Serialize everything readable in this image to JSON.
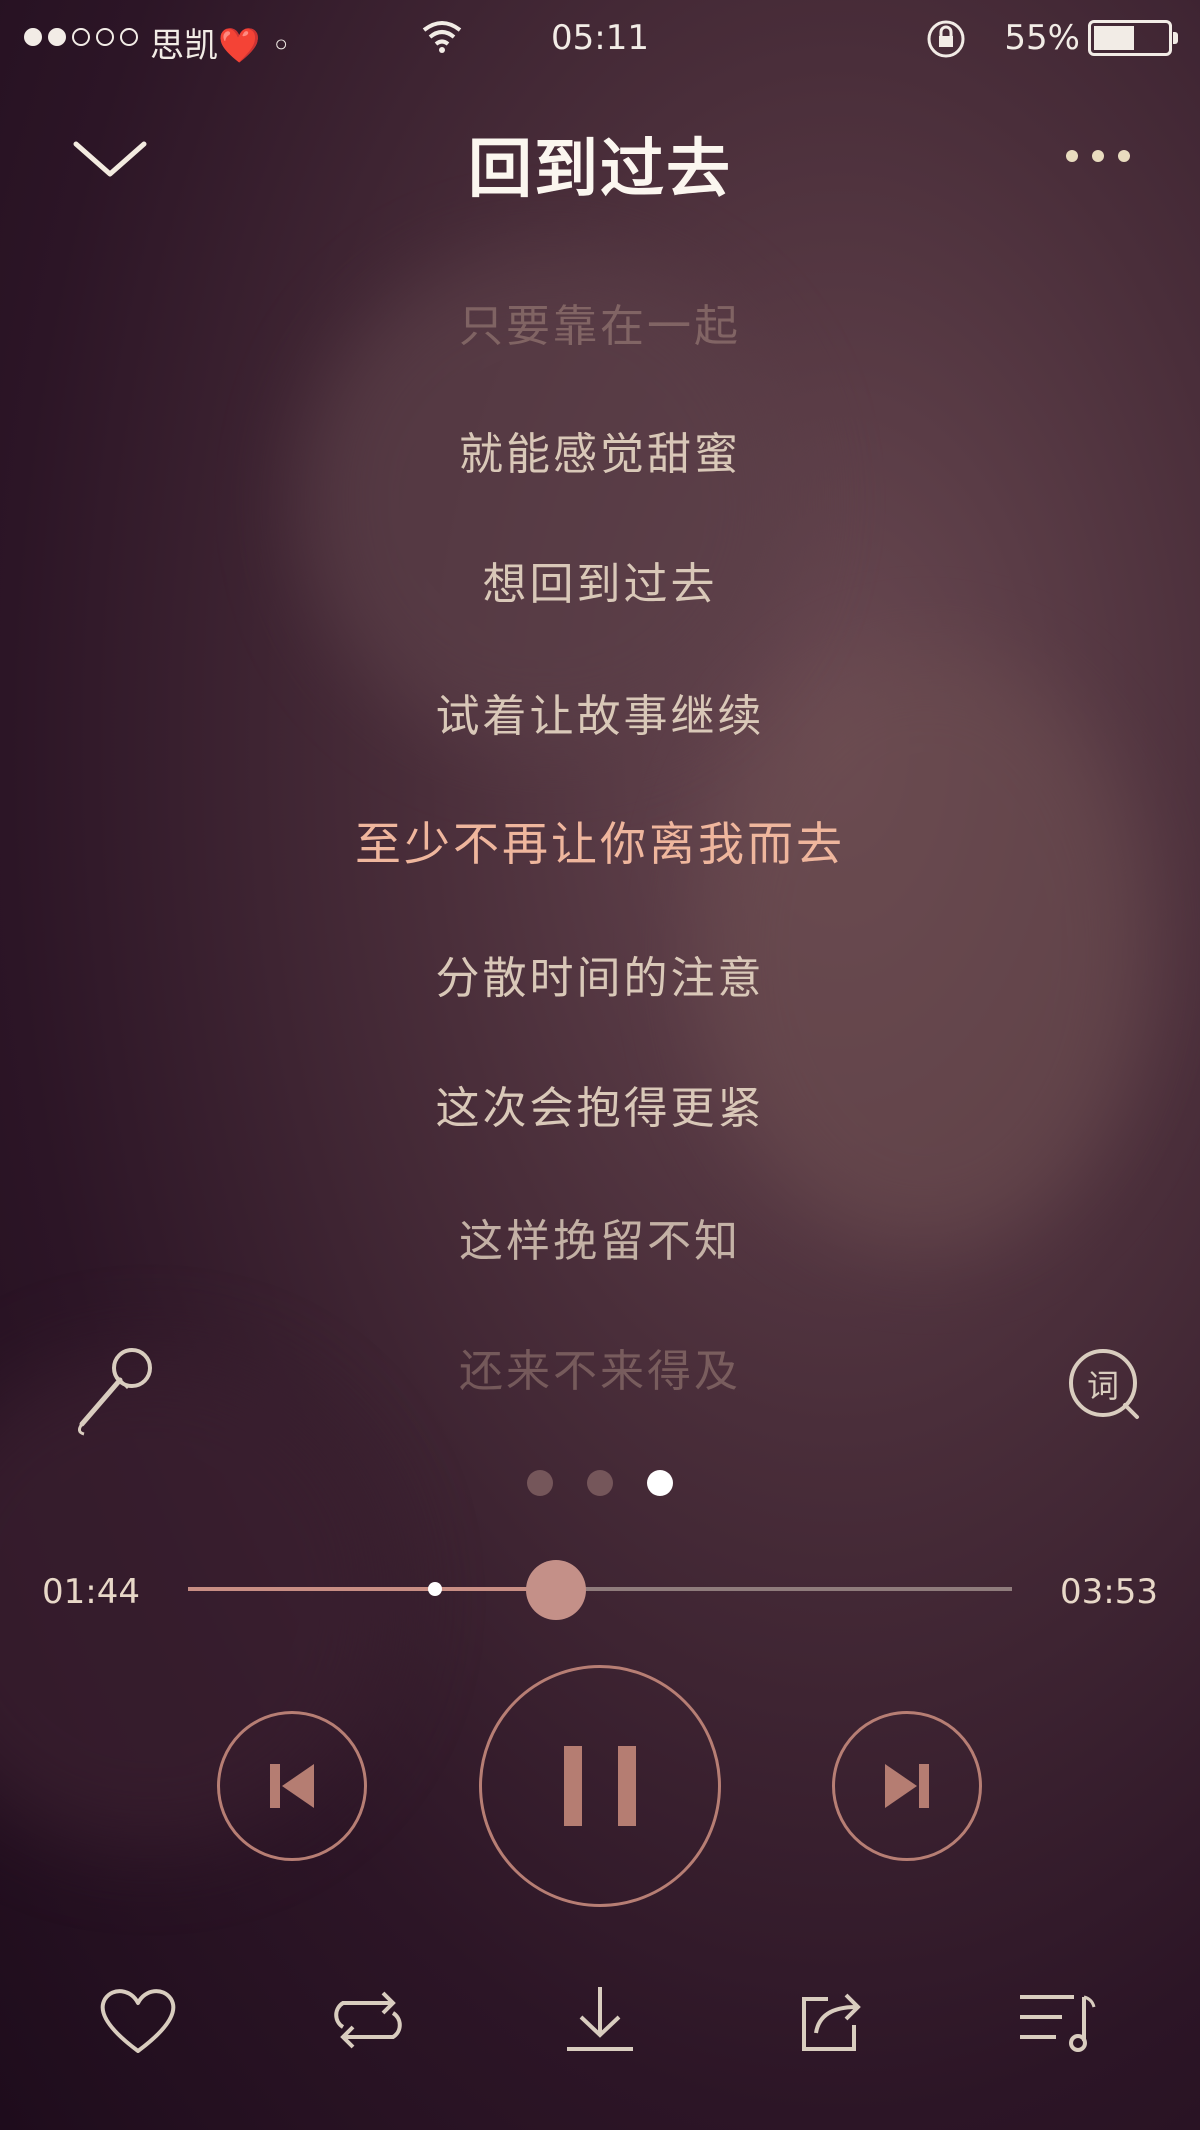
{
  "status_bar": {
    "signal_dots": [
      true,
      true,
      false,
      false,
      false
    ],
    "carrier": "思凯❤️ ◦",
    "time": "05:11",
    "battery_percent": "55%",
    "battery_level": 0.55
  },
  "header": {
    "title": "回到过去",
    "back_icon": "chevron-down-icon",
    "more_icon": "more-dots-icon"
  },
  "lyrics": [
    "只要靠在一起",
    "就能感觉甜蜜",
    "想回到过去",
    "试着让故事继续",
    "至少不再让你离我而去",
    "分散时间的注意",
    "这次会抱得更紧",
    "这样挽留不知",
    "还来不来得及"
  ],
  "current_lyric_index": 4,
  "side_actions": {
    "karaoke_icon": "microphone-icon",
    "lyrics_button_label": "词"
  },
  "pager": {
    "pages": 3,
    "active": 2
  },
  "progress": {
    "elapsed": "01:44",
    "duration": "03:53",
    "played_fraction": 0.446,
    "buffered_fraction": 0.3
  },
  "controls": {
    "previous_icon": "skip-previous-icon",
    "play_pause_icon": "pause-icon",
    "next_icon": "skip-next-icon"
  },
  "bottom_bar": [
    "heart-icon",
    "repeat-icon",
    "download-icon",
    "share-icon",
    "playlist-icon"
  ],
  "colors": {
    "accent": "#c49088",
    "control_ring": "#b77e74",
    "current_lyric": "#efb69d"
  }
}
